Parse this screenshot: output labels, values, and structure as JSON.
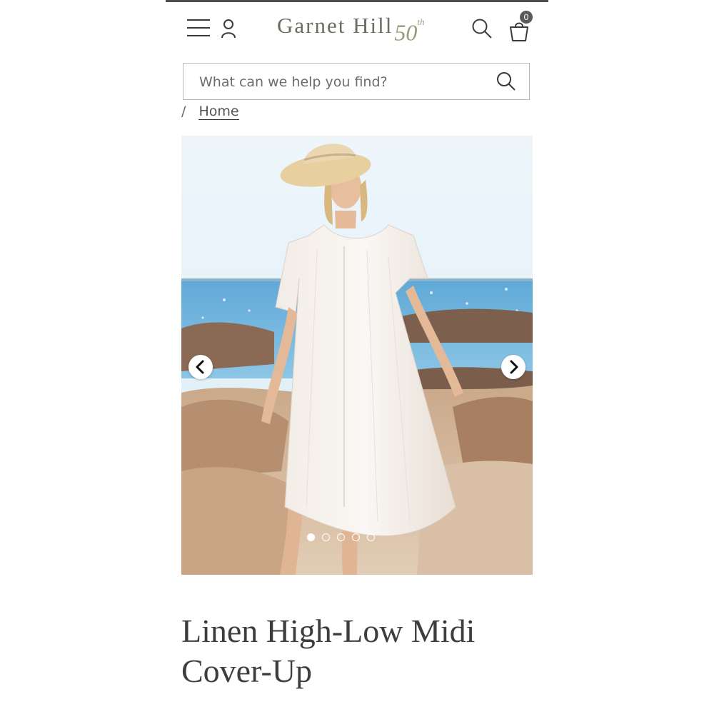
{
  "header": {
    "logo_text": "Garnet Hill",
    "logo_anniversary": "50",
    "logo_anniversary_suffix": "th",
    "cart_count": "0",
    "icons": [
      "hamburger-menu-icon",
      "account-icon",
      "search-icon",
      "shopping-bag-icon"
    ]
  },
  "search": {
    "placeholder": "What can we help you find?",
    "value": ""
  },
  "breadcrumb": {
    "separator": "/",
    "home_label": "Home"
  },
  "gallery": {
    "slide_count": 5,
    "active_index": 0,
    "icons": [
      "chevron-left-icon",
      "chevron-right-icon"
    ]
  },
  "product": {
    "title": "Linen High-Low Midi Cover-Up"
  },
  "colors": {
    "text": "#3d3d3d",
    "logo": "#6b6e63",
    "badge": "#5a5a5a",
    "border": "#b9b9b9"
  }
}
